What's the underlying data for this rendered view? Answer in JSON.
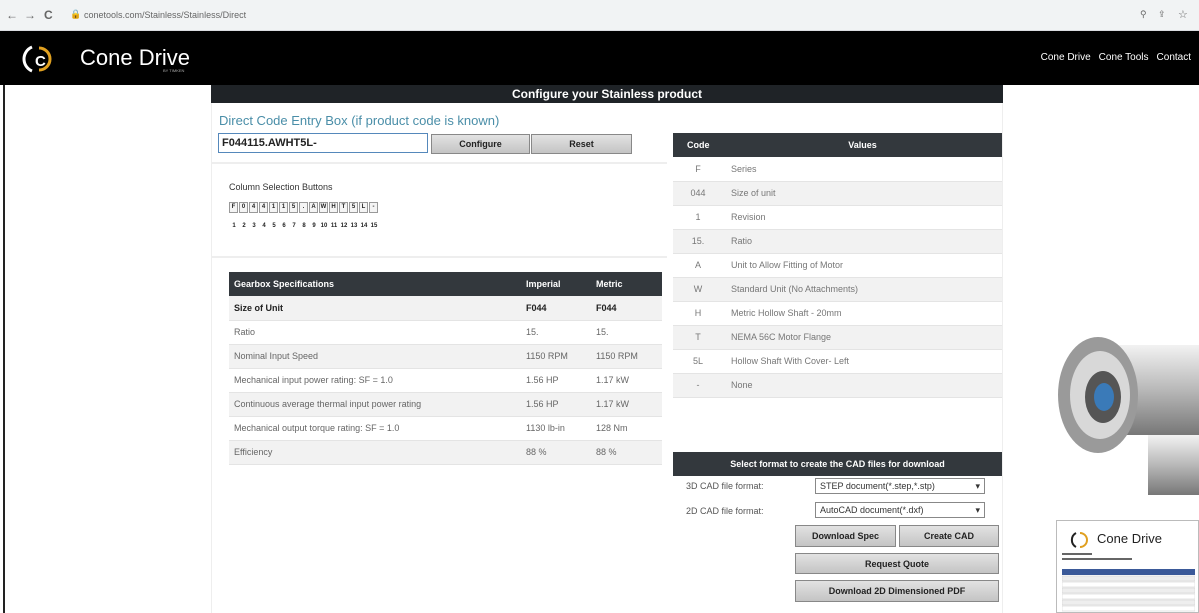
{
  "browser": {
    "url": "conetools.com/Stainless/Stainless/Direct",
    "back": "←",
    "forward": "→",
    "reload": "C"
  },
  "header": {
    "logo_text": "Cone Drive",
    "logo_sub": "BY TIMKEN",
    "nav": [
      "Cone Drive",
      "Cone Tools",
      "Contact"
    ]
  },
  "main": {
    "title": "Configure your Stainless product",
    "direct_code_title": "Direct Code Entry Box (if product code is known)",
    "code_value": "F044115.AWHT5L-",
    "configure_label": "Configure",
    "reset_label": "Reset",
    "column_selection_title": "Column Selection Buttons",
    "columns": [
      "F",
      "0",
      "4",
      "4",
      "1",
      "1",
      "5",
      ".",
      "A",
      "W",
      "H",
      "T",
      "5",
      "L",
      "-"
    ],
    "column_numbers": [
      "1",
      "2",
      "3",
      "4",
      "5",
      "6",
      "7",
      "8",
      "9",
      "10",
      "11",
      "12",
      "13",
      "14",
      "15"
    ]
  },
  "specs": {
    "headers": [
      "Gearbox Specifications",
      "Imperial",
      "Metric"
    ],
    "rows": [
      [
        "Size of Unit",
        "F044",
        "F044"
      ],
      [
        "Ratio",
        "15.",
        "15."
      ],
      [
        "Nominal Input Speed",
        "1150 RPM",
        "1150 RPM"
      ],
      [
        "Mechanical input power rating: SF = 1.0",
        "1.56 HP",
        "1.17 kW"
      ],
      [
        "Continuous average thermal input power rating",
        "1.56 HP",
        "1.17 kW"
      ],
      [
        "Mechanical output torque rating: SF = 1.0",
        "1130 lb-in",
        "128 Nm"
      ],
      [
        "Efficiency",
        "88 %",
        "88 %"
      ]
    ]
  },
  "codes": {
    "headers": [
      "Code",
      "Values"
    ],
    "rows": [
      [
        "F",
        "Series"
      ],
      [
        "044",
        "Size of unit"
      ],
      [
        "1",
        "Revision"
      ],
      [
        "15.",
        "Ratio"
      ],
      [
        "A",
        "Unit to Allow Fitting of Motor"
      ],
      [
        "W",
        "Standard Unit (No Attachments)"
      ],
      [
        "H",
        "Metric Hollow Shaft - 20mm"
      ],
      [
        "T",
        "NEMA 56C Motor Flange"
      ],
      [
        "5L",
        "Hollow Shaft With Cover- Left"
      ],
      [
        "-",
        "None"
      ]
    ]
  },
  "cad": {
    "header": "Select format to create the CAD files for download",
    "format3d_label": "3D CAD file format:",
    "format3d_value": "STEP document(*.step,*.stp)",
    "format2d_label": "2D CAD file format:",
    "format2d_value": "AutoCAD document(*.dxf)",
    "download_spec": "Download Spec",
    "create_cad": "Create CAD",
    "request_quote": "Request Quote",
    "download_2d": "Download 2D Dimensioned PDF"
  },
  "brochure": {
    "logo_text": "Cone Drive"
  },
  "colors": {
    "header_bg": "#000000",
    "table_header_bg": "#33383d",
    "accent": "#4a8ea8",
    "logo_ring": "#e0a020"
  }
}
